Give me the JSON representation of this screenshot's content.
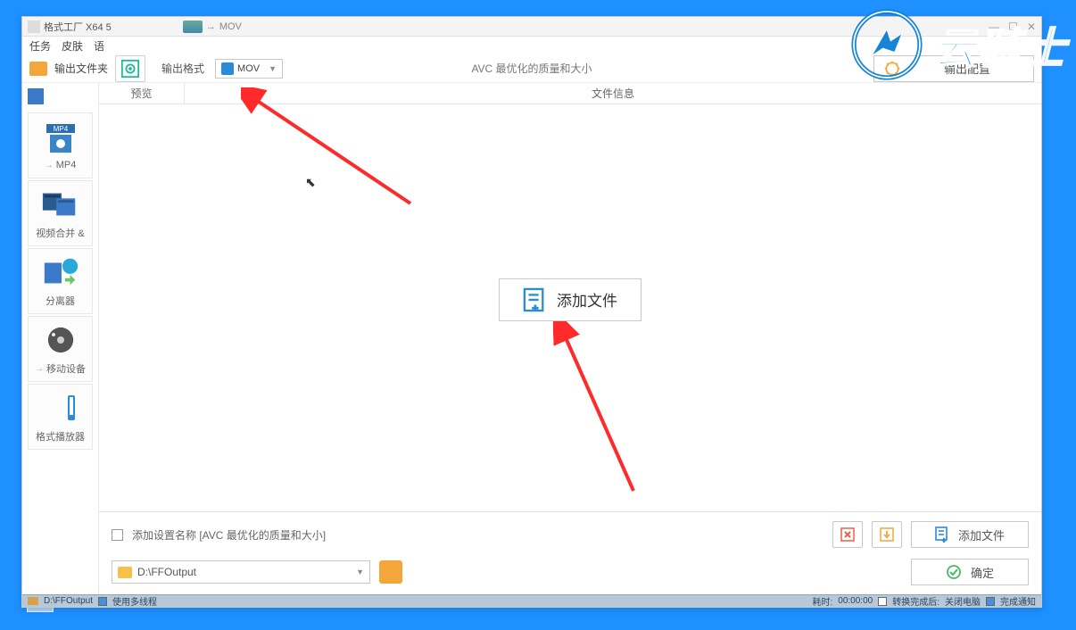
{
  "window": {
    "title": "格式工厂 X64 5",
    "breadcrumb_current": "MOV"
  },
  "menubar": {
    "items": [
      "任务",
      "皮肤",
      "语"
    ]
  },
  "toolbar": {
    "output_folder_label": "输出文件夹",
    "format_label": "输出格式",
    "format_selected": "MOV",
    "quality_text": "AVC 最优化的质量和大小",
    "output_config_label": "输出配置"
  },
  "columns": {
    "preview": "预览",
    "fileinfo": "文件信息"
  },
  "sidebar": {
    "items": [
      {
        "label": "MP4"
      },
      {
        "label": "视频合并 &"
      },
      {
        "label": "分离器"
      },
      {
        "label": "移动设备"
      },
      {
        "label": "格式播放器"
      }
    ]
  },
  "center": {
    "add_file_label": "添加文件"
  },
  "bottom": {
    "append_settings_label": "添加设置名称 [AVC 最优化的质量和大小]",
    "add_file_button": "添加文件",
    "ok_button": "确定",
    "output_path": "D:\\FFOutput"
  },
  "statusbar": {
    "path": "D:\\FFOutput",
    "multithread": "使用多线程",
    "elapsed_label": "耗时:",
    "elapsed_value": "00:00:00",
    "after_convert": "转换完成后:",
    "shutdown": "关闭电脑",
    "notify": "完成通知"
  },
  "watermark": {
    "text": "云骑士"
  }
}
